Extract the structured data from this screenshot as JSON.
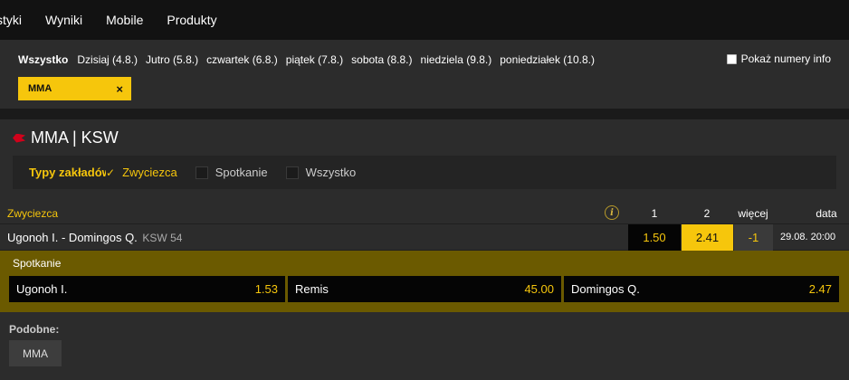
{
  "topnav": {
    "items": [
      "styki",
      "Wyniki",
      "Mobile",
      "Produkty"
    ]
  },
  "filters": {
    "days": [
      "Wszystko",
      "Dzisiaj (4.8.)",
      "Jutro (5.8.)",
      "czwartek (6.8.)",
      "piątek (7.8.)",
      "sobota (8.8.)",
      "niedziela (9.8.)",
      "poniedziałek (10.8.)"
    ],
    "show_info_label": "Pokaż numery info",
    "chip_label": "MMA",
    "chip_close": "×"
  },
  "section": {
    "title": "MMA | KSW",
    "types_label": "Typy zakładów",
    "check_mark": "✓",
    "types": [
      "Zwyciezca",
      "Spotkanie",
      "Wszystko"
    ]
  },
  "market": {
    "name": "Zwyciezca",
    "info_icon": "i",
    "columns": [
      "1",
      "2",
      "więcej",
      "data"
    ]
  },
  "event": {
    "name": "Ugonoh I. - Domingos Q.",
    "league": "KSW 54",
    "odd1": "1.50",
    "odd2": "2.41",
    "more": "-1",
    "date": "29.08. 20:00"
  },
  "spotkanie": {
    "label": "Spotkanie",
    "outcomes": [
      {
        "name": "Ugonoh I.",
        "odd": "1.53"
      },
      {
        "name": "Remis",
        "odd": "45.00"
      },
      {
        "name": "Domingos Q.",
        "odd": "2.47"
      }
    ]
  },
  "similar": {
    "label": "Podobne:",
    "chip": "MMA"
  },
  "colors": {
    "accent": "#f6c60c",
    "background": "#2c2c2c",
    "nav": "#121212",
    "spotkanie_bg": "#6b5a00"
  }
}
